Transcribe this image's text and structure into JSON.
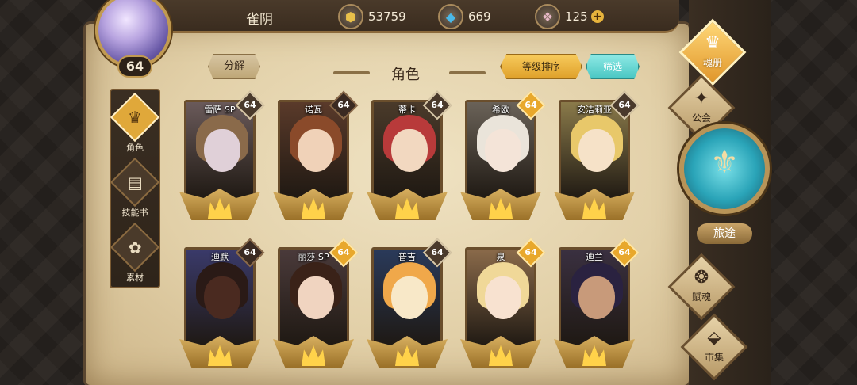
{
  "player": {
    "name": "雀阴",
    "level": "64"
  },
  "resources": [
    {
      "icon": "gold-coin-icon",
      "glyph": "⬢",
      "color": "#e8c04a",
      "value": "53759"
    },
    {
      "icon": "blue-crystal-icon",
      "glyph": "◆",
      "color": "#4ab8e8",
      "value": "669"
    },
    {
      "icon": "pink-gem-icon",
      "glyph": "❖",
      "color": "#e8b8c8",
      "value": "125"
    }
  ],
  "left_tabs": [
    {
      "label": "角色",
      "glyph": "♛",
      "active": true
    },
    {
      "label": "技能书",
      "glyph": "▤",
      "active": false
    },
    {
      "label": "素材",
      "glyph": "✿",
      "active": false
    }
  ],
  "header": {
    "split_label": "分解",
    "title": "角色",
    "sort_label": "等级排序",
    "filter_label": "筛选"
  },
  "cards": [
    {
      "name": "雷萨 SP",
      "level": "64",
      "badge": "silver",
      "hair": "#8a6a4a",
      "bg": "#6a5a5a",
      "skin": "#e0d0d8"
    },
    {
      "name": "诺瓦",
      "level": "64",
      "badge": "dark",
      "hair": "#8a4a2a",
      "bg": "#5a3a2a",
      "skin": "#f0d2b8"
    },
    {
      "name": "蒂卡",
      "level": "64",
      "badge": "silver",
      "hair": "#b83a3a",
      "bg": "#4a3a2a",
      "skin": "#f2d8c0"
    },
    {
      "name": "希欧",
      "level": "64",
      "badge": "gold",
      "hair": "#eae4da",
      "bg": "#6a6258",
      "skin": "#f4e4d8"
    },
    {
      "name": "安洁莉亚",
      "level": "64",
      "badge": "silver",
      "hair": "#e8c86a",
      "bg": "#8a7a4a",
      "skin": "#f6e2c8"
    },
    {
      "name": "迪默",
      "level": "64",
      "badge": "dark",
      "hair": "#2a1a16",
      "bg": "#3a3a6a",
      "skin": "#4a2a20"
    },
    {
      "name": "丽莎 SP",
      "level": "64",
      "badge": "gold",
      "hair": "#3a2218",
      "bg": "#4a3a3a",
      "skin": "#f0d4c0"
    },
    {
      "name": "普吉",
      "level": "64",
      "badge": "silver",
      "hair": "#f0a84a",
      "bg": "#2a3a5a",
      "skin": "#f8e8c8"
    },
    {
      "name": "泉",
      "level": "64",
      "badge": "gold",
      "hair": "#f0d898",
      "bg": "#8a6a4a",
      "skin": "#f8e2d0"
    },
    {
      "name": "迪兰",
      "level": "64",
      "badge": "gold",
      "hair": "#2a2240",
      "bg": "#3a3040",
      "skin": "#c89a7a"
    }
  ],
  "right_menu": [
    {
      "label": "魂册",
      "glyph": "♛",
      "active": true
    },
    {
      "label": "公会",
      "glyph": "✦",
      "active": false
    },
    {
      "label": "赋魂",
      "glyph": "❂",
      "active": false
    },
    {
      "label": "市集",
      "glyph": "⬙",
      "active": false
    }
  ],
  "journey": {
    "label": "旅途",
    "glyph": "⚜"
  }
}
